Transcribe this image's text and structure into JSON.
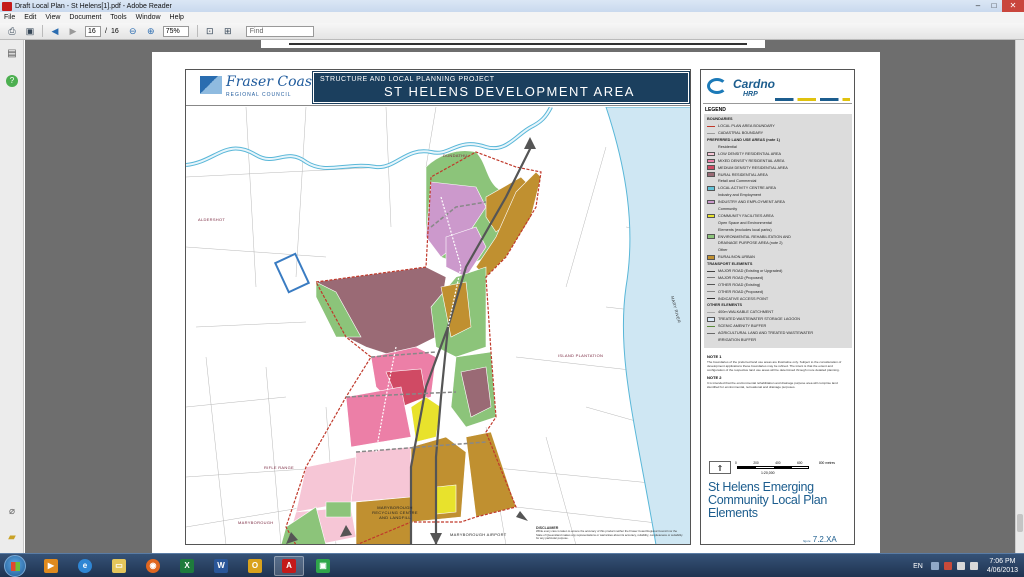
{
  "window": {
    "title": "Draft Local Plan - St Helens[1].pdf - Adobe Reader",
    "minimize": "–",
    "maximize": "□",
    "close": "✕"
  },
  "menu": [
    "File",
    "Edit",
    "View",
    "Document",
    "Tools",
    "Window",
    "Help"
  ],
  "toolbar": {
    "page_current": "16",
    "page_separator": "/",
    "page_total": "16",
    "zoom": "75%",
    "find_placeholder": "Find"
  },
  "map": {
    "logo_word": "Fraser Coast",
    "logo_sub": "REGIONAL COUNCIL",
    "project_title": "STRUCTURE AND LOCAL PLANNING PROJECT",
    "main_title": "ST HELENS DEVELOPMENT AREA",
    "labels": {
      "dundathu": "DUNDATHU",
      "aldershot": "ALDERSHOT",
      "island_plantation": "ISLAND PLANTATION",
      "rifle_range": "RIFLE RANGE",
      "maryborough": "MARYBOROUGH",
      "recycling": "MARYBOROUGH RECYCLING CENTRE AND LANDFILL",
      "airport": "MARYBOROUGH AIRPORT",
      "river": "MARY RIVER"
    }
  },
  "panel": {
    "brand": "Cardno",
    "brand_sub": "HRP",
    "legend_title": "LEGEND",
    "legend": [
      {
        "type": "head",
        "text": "BOUNDARIES"
      },
      {
        "type": "line",
        "color": "#c0392b",
        "text": "LOCAL PLAN AREA BOUNDARY"
      },
      {
        "type": "line",
        "color": "#999999",
        "text": "CADASTRAL BOUNDARY"
      },
      {
        "type": "head",
        "text": "PREFERRED LAND USE AREAS (note 1)"
      },
      {
        "type": "sub",
        "text": "Residential"
      },
      {
        "type": "swatch",
        "color": "#f6c6d6",
        "text": "LOW DENSITY RESIDENTIAL AREA"
      },
      {
        "type": "swatch",
        "color": "#ec7fa7",
        "text": "MIXED DENSITY RESIDENTIAL AREA"
      },
      {
        "type": "swatch",
        "color": "#d04a64",
        "text": "MEDIUM DENSITY RESIDENTIAL AREA"
      },
      {
        "type": "swatch",
        "color": "#9a6a75",
        "text": "RURAL RESIDENTIAL AREA"
      },
      {
        "type": "sub",
        "text": "Retail and Commercial"
      },
      {
        "type": "swatch",
        "color": "#64c3d8",
        "text": "LOCAL ACTIVITY CENTRE AREA"
      },
      {
        "type": "sub",
        "text": "Industry and Employment"
      },
      {
        "type": "swatch",
        "color": "#cc99cc",
        "text": "INDUSTRY AND EMPLOYMENT AREA"
      },
      {
        "type": "sub",
        "text": "Community"
      },
      {
        "type": "swatch",
        "color": "#e8e22c",
        "text": "COMMUNITY FACILITIES AREA"
      },
      {
        "type": "sub",
        "text": "Open Space and Environmental"
      },
      {
        "type": "sub",
        "text": "Elements (excludes local parks)"
      },
      {
        "type": "swatch",
        "color": "#8cc47a",
        "text": "ENVIRONMENTAL REHABILITATION AND"
      },
      {
        "type": "sub",
        "text": "DRAINAGE PURPOSE AREA (note 2)"
      },
      {
        "type": "sub",
        "text": "Other"
      },
      {
        "type": "swatch",
        "color": "#c09030",
        "text": "RURAL/NON-URBAN"
      },
      {
        "type": "head",
        "text": "TRANSPORT ELEMENTS"
      },
      {
        "type": "line",
        "color": "#444444",
        "text": "MAJOR ROAD (Existing or Upgraded)"
      },
      {
        "type": "line",
        "color": "#777777",
        "text": "MAJOR ROAD (Proposed)"
      },
      {
        "type": "line",
        "color": "#555555",
        "text": "OTHER ROAD (Existing)"
      },
      {
        "type": "line",
        "color": "#888888",
        "text": "OTHER ROAD (Proposed)"
      },
      {
        "type": "line",
        "color": "#333333",
        "text": "INDICATIVE ACCESS POINT"
      },
      {
        "type": "head",
        "text": "OTHER ELEMENTS"
      },
      {
        "type": "line",
        "color": "#aaaaaa",
        "text": "400m WALKABLE CATCHMENT"
      },
      {
        "type": "swatch",
        "color": "#dbe9f5",
        "text": "TREATED WASTEWATER STORAGE LAGOON"
      },
      {
        "type": "line",
        "color": "#5a8a3a",
        "text": "SCENIC AMENITY BUFFER"
      },
      {
        "type": "line",
        "color": "#6a6a6a",
        "text": "AGRICULTURAL LAND AND TREATED WASTEWATER"
      },
      {
        "type": "sub",
        "text": "IRRIGATION BUFFER"
      }
    ],
    "note1_title": "NOTE 1",
    "note1_text": "The boundaries of the preferred land use areas are illustrative only. Subject to the consideration of development applications these boundaries may be refined. The intent is that the extent and configuration of the respective land use areas will be determined through more detailed planning.",
    "note2_title": "NOTE 2",
    "note2_text": "It is intended that the environmental rehabilitation and drainage purpose area will comprise land identified for environmental, recreational and drainage purposes.",
    "scale_values": [
      "0",
      "200",
      "400",
      "600",
      "800 metres"
    ],
    "scale_ratio": "1:20,000",
    "plan_title": "St Helens Emerging Community Local Plan Elements",
    "fig_prefix": "figure",
    "fig_number": "7.2.XA",
    "disclaimer_title": "DISCLAIMER",
    "disclaimer_text": "While every care is taken to ensure the accuracy of this product neither the Fraser Coast Regional Council nor the State of Queensland makes any representations or warranties about its accuracy, reliability, completeness or suitability for any particular purpose."
  },
  "taskbar": {
    "language": "EN",
    "time": "7:06 PM",
    "date": "4/06/2013"
  }
}
